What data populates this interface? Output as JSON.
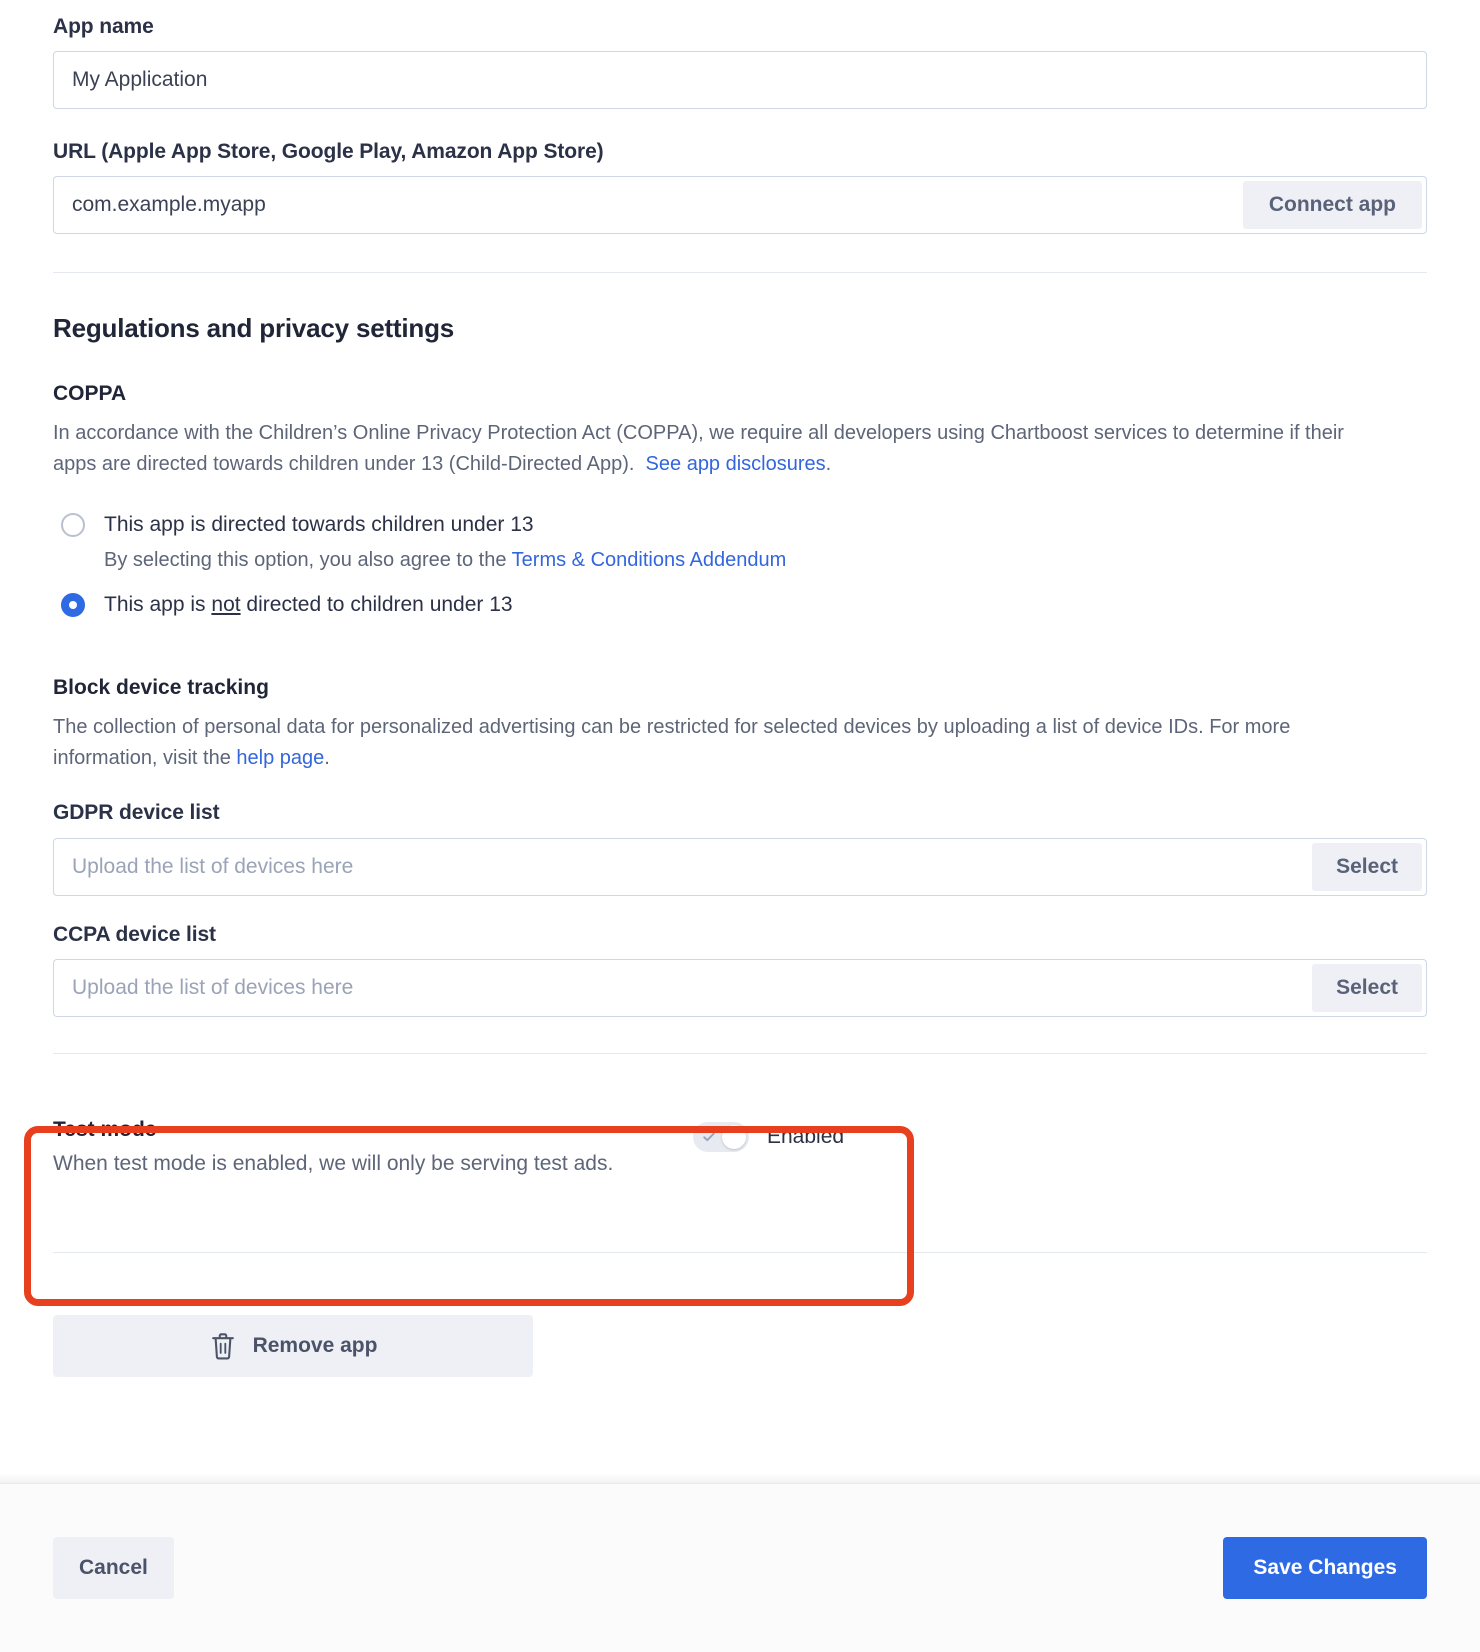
{
  "app_name": {
    "label": "App name",
    "value": "My Application"
  },
  "url": {
    "label": "URL (Apple App Store, Google Play, Amazon App Store)",
    "value": "com.example.myapp",
    "connect_label": "Connect app"
  },
  "regulations": {
    "title": "Regulations and privacy settings",
    "coppa": {
      "title": "COPPA",
      "description_part1": "In accordance with the Children’s Online Privacy Protection Act (COPPA), we require all developers using Chartboost services to determine if their apps are directed towards children under 13 (Child-Directed App).",
      "link_text": "See app disclosures",
      "description_end": ".",
      "option_directed": "This app is directed towards children under 13",
      "option_directed_sub_prefix": "By selecting this option, you also agree to the ",
      "option_directed_sub_link": "Terms & Conditions Addendum",
      "option_not_directed_prefix": "This app is ",
      "option_not_directed_emphasis": "not",
      "option_not_directed_suffix": " directed to children under 13",
      "selected": "not_directed"
    },
    "block_device_tracking": {
      "title": "Block device tracking",
      "description_part1": "The collection of personal data for personalized advertising can be restricted for selected devices by uploading a list of device IDs. For more information, visit the ",
      "link_text": "help page",
      "description_end": ".",
      "gdpr_label": "GDPR device list",
      "gdpr_placeholder": "Upload the list of devices here",
      "gdpr_value": "",
      "gdpr_select_label": "Select",
      "ccpa_label": "CCPA device list",
      "ccpa_placeholder": "Upload the list of devices here",
      "ccpa_value": "",
      "ccpa_select_label": "Select"
    }
  },
  "test_mode": {
    "title": "Test mode",
    "description": "When test mode is enabled, we will only be serving test ads.",
    "toggle_state_label": "Enabled",
    "enabled": true,
    "highlight_color": "#e8401f"
  },
  "remove_app": {
    "label": "Remove app",
    "icon": "trash-icon"
  },
  "footer": {
    "cancel_label": "Cancel",
    "save_label": "Save Changes",
    "save_color": "#2f6ae5"
  }
}
